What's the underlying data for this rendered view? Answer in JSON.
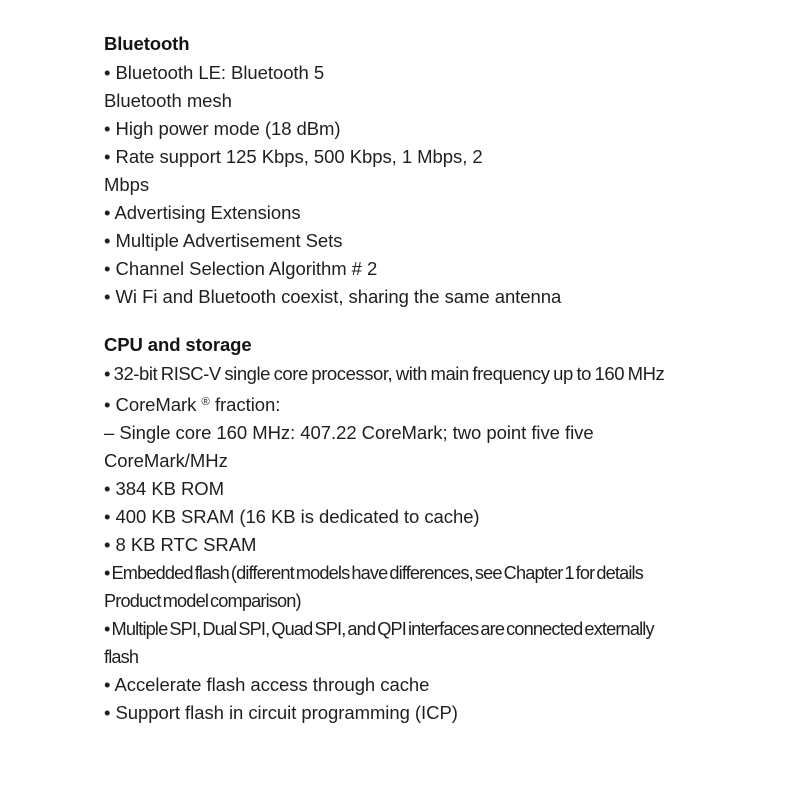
{
  "document": {
    "background_color": "#ffffff",
    "text_color": "#1c1c1c",
    "sections": [
      {
        "heading": "Bluetooth",
        "bullets": [
          "• Bluetooth LE: Bluetooth 5\nBluetooth mesh",
          "• High power mode (18 dBm)",
          "• Rate support 125 Kbps, 500 Kbps, 1 Mbps, 2\nMbps",
          "• Advertising Extensions",
          "• Multiple Advertisement Sets",
          "• Channel Selection Algorithm # 2",
          "• Wi Fi and Bluetooth coexist, sharing the same antenna"
        ]
      },
      {
        "heading": "CPU and storage",
        "bullets": [
          "• 32-bit RISC-V single core processor, with main frequency up to 160 MHz",
          "• CoreMark ® fraction:",
          "– Single core 160 MHz: 407.22 CoreMark; two point five five\nCoreMark/MHz",
          "• 384 KB ROM",
          "• 400 KB SRAM (16 KB is dedicated to cache)",
          "• 8 KB RTC SRAM",
          "• Embedded flash (different models have differences, see Chapter 1 for details\nProduct model comparison)",
          "• Multiple SPI, Dual SPI, Quad SPI, and QPI interfaces are connected externally\nflash",
          "• Accelerate flash access through cache",
          "• Support flash in circuit programming (ICP)"
        ]
      }
    ]
  },
  "parts": {
    "coremark_prefix": "• CoreMark ",
    "coremark_mark": "®",
    "coremark_suffix": " fraction:"
  }
}
